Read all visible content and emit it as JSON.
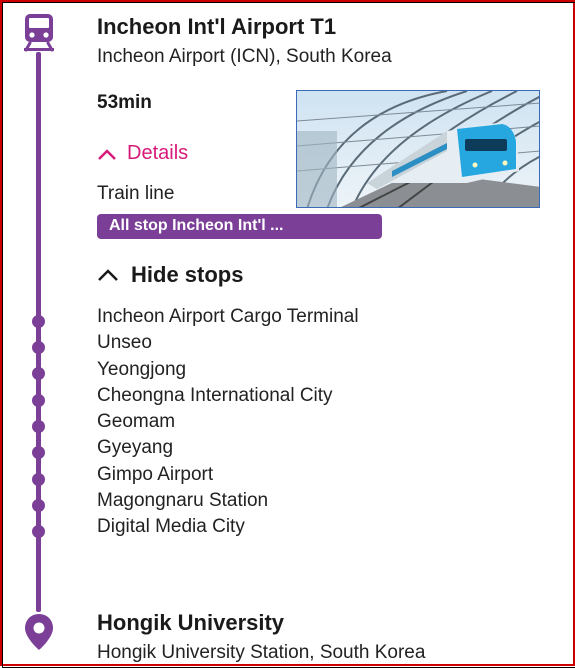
{
  "origin": {
    "title": "Incheon Int'l Airport T1",
    "subtitle": "Incheon Airport (ICN), South Korea"
  },
  "trip": {
    "duration": "53min"
  },
  "details": {
    "toggle_label": "Details",
    "train_line_label": "Train line",
    "line_badge": "All stop Incheon Int'l ..."
  },
  "stops_toggle": {
    "label": "Hide stops"
  },
  "stops": [
    "Incheon Airport Cargo Terminal",
    "Unseo",
    "Yeongjong",
    "Cheongna International City",
    "Geomam",
    "Gyeyang",
    "Gimpo Airport",
    "Magongnaru Station",
    "Digital Media City"
  ],
  "destination": {
    "title": "Hongik University",
    "subtitle": "Hongik University Station, South Korea"
  },
  "colors": {
    "line": "#7b3f98",
    "accent": "#d81b7a"
  },
  "icons": {
    "origin": "train-icon",
    "destination": "location-pin-icon"
  }
}
